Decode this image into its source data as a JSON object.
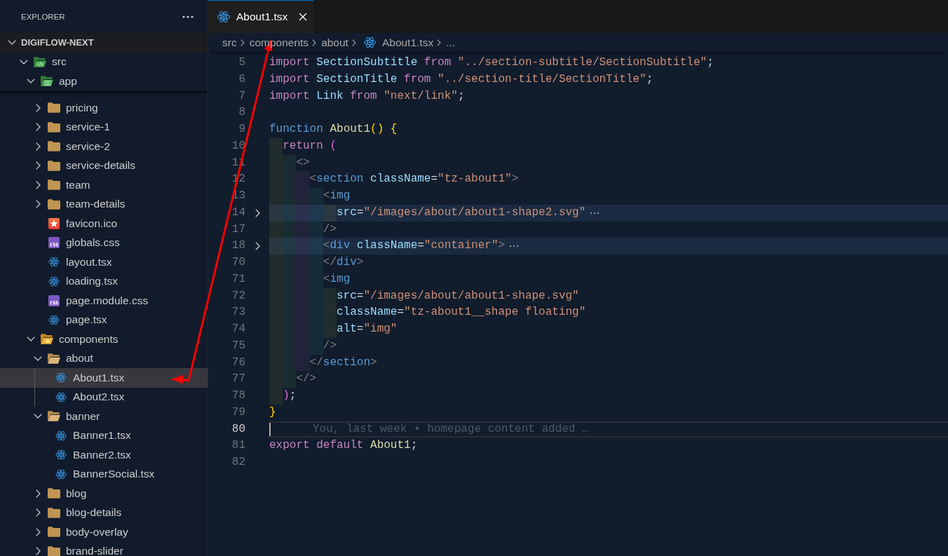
{
  "sidebar": {
    "title": "EXPLORER",
    "root": {
      "label": "DIGIFLOW-NEXT",
      "expanded": true,
      "children": [
        {
          "label": "src",
          "kind": "source-folder",
          "expanded": true,
          "selected": false,
          "children": [
            {
              "label": "app",
              "kind": "app-folder",
              "expanded": true,
              "selected": false,
              "children": [
                {
                  "label": "pricing",
                  "kind": "folder",
                  "expanded": false,
                  "selected": false
                },
                {
                  "label": "service-1",
                  "kind": "folder",
                  "expanded": false,
                  "selected": false
                },
                {
                  "label": "service-2",
                  "kind": "folder",
                  "expanded": false,
                  "selected": false
                },
                {
                  "label": "service-details",
                  "kind": "folder",
                  "expanded": false,
                  "selected": false
                },
                {
                  "label": "team",
                  "kind": "folder",
                  "expanded": false,
                  "selected": false
                },
                {
                  "label": "team-details",
                  "kind": "folder",
                  "expanded": false,
                  "selected": false
                },
                {
                  "label": "favicon.ico",
                  "kind": "favicon-file",
                  "selected": false
                },
                {
                  "label": "globals.css",
                  "kind": "css-file",
                  "selected": false
                },
                {
                  "label": "layout.tsx",
                  "kind": "react-file",
                  "selected": false
                },
                {
                  "label": "loading.tsx",
                  "kind": "react-file",
                  "selected": false
                },
                {
                  "label": "page.module.css",
                  "kind": "css-file",
                  "selected": false
                },
                {
                  "label": "page.tsx",
                  "kind": "react-file",
                  "selected": false
                }
              ]
            },
            {
              "label": "components",
              "kind": "components-folder",
              "expanded": true,
              "selected": false,
              "children": [
                {
                  "label": "about",
                  "kind": "folder",
                  "expanded": true,
                  "selected": false,
                  "children": [
                    {
                      "label": "About1.tsx",
                      "kind": "react-file",
                      "selected": true
                    },
                    {
                      "label": "About2.tsx",
                      "kind": "react-file",
                      "selected": false
                    }
                  ]
                },
                {
                  "label": "banner",
                  "kind": "folder",
                  "expanded": true,
                  "selected": false,
                  "children": [
                    {
                      "label": "Banner1.tsx",
                      "kind": "react-file",
                      "selected": false
                    },
                    {
                      "label": "Banner2.tsx",
                      "kind": "react-file",
                      "selected": false
                    },
                    {
                      "label": "BannerSocial.tsx",
                      "kind": "react-file",
                      "selected": false
                    }
                  ]
                },
                {
                  "label": "blog",
                  "kind": "folder",
                  "expanded": false,
                  "selected": false
                },
                {
                  "label": "blog-details",
                  "kind": "folder",
                  "expanded": false,
                  "selected": false
                },
                {
                  "label": "body-overlay",
                  "kind": "folder",
                  "expanded": false,
                  "selected": false
                },
                {
                  "label": "brand-slider",
                  "kind": "folder",
                  "expanded": false,
                  "selected": false
                }
              ]
            }
          ]
        }
      ]
    }
  },
  "tabs": [
    {
      "label": "About1.tsx",
      "kind": "react-file",
      "selected": true
    }
  ],
  "breadcrumbs": [
    {
      "label": "src",
      "kind": "folder"
    },
    {
      "label": "components",
      "kind": "folder"
    },
    {
      "label": "about",
      "kind": "folder"
    },
    {
      "label": "About1.tsx",
      "kind": "react-file"
    },
    {
      "label": "...",
      "kind": "more"
    }
  ],
  "editor": {
    "lines": [
      {
        "number": "5",
        "folded": false,
        "current": false,
        "tokens": [
          {
            "kind": "keyword",
            "text": "import "
          },
          {
            "kind": "variable",
            "text": "SectionSubtitle "
          },
          {
            "kind": "keyword",
            "text": "from "
          },
          {
            "kind": "string",
            "text": "\"../section-subtitle/SectionSubtitle\""
          },
          {
            "kind": "punct",
            "text": ";"
          }
        ]
      },
      {
        "number": "6",
        "folded": false,
        "current": false,
        "tokens": [
          {
            "kind": "keyword",
            "text": "import "
          },
          {
            "kind": "variable",
            "text": "SectionTitle "
          },
          {
            "kind": "keyword",
            "text": "from "
          },
          {
            "kind": "string",
            "text": "\"../section-title/SectionTitle\""
          },
          {
            "kind": "punct",
            "text": ";"
          }
        ]
      },
      {
        "number": "7",
        "folded": false,
        "current": false,
        "tokens": [
          {
            "kind": "keyword",
            "text": "import "
          },
          {
            "kind": "variable",
            "text": "Link "
          },
          {
            "kind": "keyword",
            "text": "from "
          },
          {
            "kind": "string",
            "text": "\"next/link\""
          },
          {
            "kind": "punct",
            "text": ";"
          }
        ]
      },
      {
        "number": "8",
        "folded": false,
        "current": false
      },
      {
        "number": "9",
        "folded": false,
        "current": false,
        "tokens": [
          {
            "kind": "storage",
            "text": "function "
          },
          {
            "kind": "function",
            "text": "About1"
          },
          {
            "kind": "bracket1",
            "text": "() {"
          }
        ]
      },
      {
        "number": "10",
        "folded": false,
        "current": false,
        "tokens": [
          {
            "kind": "keyword",
            "text": "  return "
          },
          {
            "kind": "bracket2",
            "text": "("
          }
        ]
      },
      {
        "number": "11",
        "folded": false,
        "current": false,
        "tokens": [
          {
            "kind": "tag-punct",
            "text": "    <>"
          }
        ]
      },
      {
        "number": "12",
        "folded": false,
        "current": false,
        "tokens": [
          {
            "kind": "tag-punct",
            "text": "      <"
          },
          {
            "kind": "tag",
            "text": "section "
          },
          {
            "kind": "attr",
            "text": "className"
          },
          {
            "kind": "punct",
            "text": "="
          },
          {
            "kind": "string",
            "text": "\"tz-about1\""
          },
          {
            "kind": "tag-punct",
            "text": ">"
          }
        ]
      },
      {
        "number": "13",
        "folded": false,
        "current": false,
        "tokens": [
          {
            "kind": "tag-punct",
            "text": "        <"
          },
          {
            "kind": "tag",
            "text": "img"
          }
        ]
      },
      {
        "number": "14",
        "folded": true,
        "current": false,
        "tokens": [
          {
            "kind": "attr",
            "text": "          src"
          },
          {
            "kind": "punct",
            "text": "="
          },
          {
            "kind": "string",
            "text": "\"/images/about/about1-shape2.svg\""
          }
        ]
      },
      {
        "number": "17",
        "folded": false,
        "current": false,
        "tokens": [
          {
            "kind": "tag-punct",
            "text": "        />"
          }
        ]
      },
      {
        "number": "18",
        "folded": true,
        "current": false,
        "tokens": [
          {
            "kind": "tag-punct",
            "text": "        <"
          },
          {
            "kind": "tag",
            "text": "div "
          },
          {
            "kind": "attr",
            "text": "className"
          },
          {
            "kind": "punct",
            "text": "="
          },
          {
            "kind": "string",
            "text": "\"container\""
          },
          {
            "kind": "tag-punct",
            "text": ">"
          }
        ]
      },
      {
        "number": "70",
        "folded": false,
        "current": false,
        "tokens": [
          {
            "kind": "tag-punct",
            "text": "        </"
          },
          {
            "kind": "tag",
            "text": "div"
          },
          {
            "kind": "tag-punct",
            "text": ">"
          }
        ]
      },
      {
        "number": "71",
        "folded": false,
        "current": false,
        "tokens": [
          {
            "kind": "tag-punct",
            "text": "        <"
          },
          {
            "kind": "tag",
            "text": "img"
          }
        ]
      },
      {
        "number": "72",
        "folded": false,
        "current": false,
        "tokens": [
          {
            "kind": "attr",
            "text": "          src"
          },
          {
            "kind": "punct",
            "text": "="
          },
          {
            "kind": "string",
            "text": "\"/images/about/about1-shape.svg\""
          }
        ]
      },
      {
        "number": "73",
        "folded": false,
        "current": false,
        "tokens": [
          {
            "kind": "attr",
            "text": "          className"
          },
          {
            "kind": "punct",
            "text": "="
          },
          {
            "kind": "string",
            "text": "\"tz-about1__shape floating\""
          }
        ]
      },
      {
        "number": "74",
        "folded": false,
        "current": false,
        "tokens": [
          {
            "kind": "attr",
            "text": "          alt"
          },
          {
            "kind": "punct",
            "text": "="
          },
          {
            "kind": "string",
            "text": "\"img\""
          }
        ]
      },
      {
        "number": "75",
        "folded": false,
        "current": false,
        "tokens": [
          {
            "kind": "tag-punct",
            "text": "        />"
          }
        ]
      },
      {
        "number": "76",
        "folded": false,
        "current": false,
        "tokens": [
          {
            "kind": "tag-punct",
            "text": "      </"
          },
          {
            "kind": "tag",
            "text": "section"
          },
          {
            "kind": "tag-punct",
            "text": ">"
          }
        ]
      },
      {
        "number": "77",
        "folded": false,
        "current": false,
        "tokens": [
          {
            "kind": "tag-punct",
            "text": "    </>"
          }
        ]
      },
      {
        "number": "78",
        "folded": false,
        "current": false,
        "tokens": [
          {
            "kind": "bracket2",
            "text": "  )"
          },
          {
            "kind": "punct",
            "text": ";"
          }
        ]
      },
      {
        "number": "79",
        "folded": false,
        "current": false,
        "tokens": [
          {
            "kind": "bracket1",
            "text": "}"
          }
        ]
      },
      {
        "number": "80",
        "folded": false,
        "current": true,
        "blame": "You, last week • homepage content added …"
      },
      {
        "number": "81",
        "folded": false,
        "current": false,
        "tokens": [
          {
            "kind": "keyword",
            "text": "export default "
          },
          {
            "kind": "function",
            "text": "About1"
          },
          {
            "kind": "punct",
            "text": ";"
          }
        ]
      },
      {
        "number": "82",
        "folded": false,
        "current": false
      }
    ]
  },
  "annotations": [
    {
      "kind": "arrow"
    }
  ]
}
